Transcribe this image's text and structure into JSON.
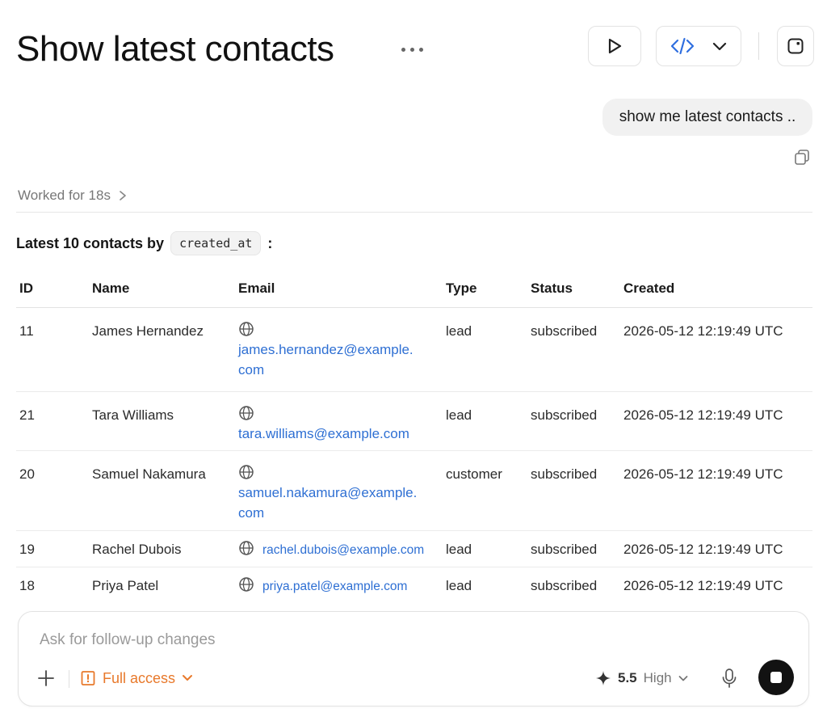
{
  "header": {
    "title": "Show latest contacts"
  },
  "conversation": {
    "user_message": "show me latest contacts ..",
    "worked_for": "Worked for 18s",
    "intro_prefix": "Latest 10 contacts by",
    "intro_code": "created_at",
    "intro_suffix": ":"
  },
  "table": {
    "columns": [
      "ID",
      "Name",
      "Email",
      "Type",
      "Status",
      "Created"
    ],
    "rows": [
      {
        "id": "11",
        "name": "James Hernandez",
        "email": "james.hernandez@example.com",
        "email_line1": "james.hernandez@example.",
        "email_line2": "com",
        "type": "lead",
        "status": "subscribed",
        "created": "2026-05-12 12:19:49 UTC"
      },
      {
        "id": "21",
        "name": "Tara Williams",
        "email": "tara.williams@example.com",
        "type": "lead",
        "status": "subscribed",
        "created": "2026-05-12 12:19:49 UTC"
      },
      {
        "id": "20",
        "name": "Samuel Nakamura",
        "email": "samuel.nakamura@example.com",
        "email_line1": "samuel.nakamura@example.",
        "email_line2": "com",
        "type": "customer",
        "status": "subscribed",
        "created": "2026-05-12 12:19:49 UTC"
      },
      {
        "id": "19",
        "name": "Rachel Dubois",
        "email": "rachel.dubois@example.com",
        "type": "lead",
        "status": "subscribed",
        "created": "2026-05-12 12:19:49 UTC"
      },
      {
        "id": "18",
        "name": "Priya Patel",
        "email": "priya.patel@example.com",
        "type": "lead",
        "status": "subscribed",
        "created": "2026-05-12 12:19:49 UTC"
      }
    ]
  },
  "composer": {
    "placeholder": "Ask for follow-up changes",
    "access_label": "Full access",
    "model_version": "5.5",
    "model_effort": "High"
  },
  "colors": {
    "link": "#2e6fd3",
    "access": "#e8792b",
    "code_icon": "#2f6fe0",
    "stop_button": "#121212"
  },
  "icons": {
    "more": "ellipsis-icon",
    "run": "play-icon",
    "code": "code-icon",
    "dropdown": "chevron-down-icon",
    "panel": "panel-toggle-icon",
    "copy": "copy-icon",
    "expand": "chevron-right-icon",
    "email": "globe-icon",
    "add": "plus-icon",
    "access": "shield-icon",
    "model": "sparkle-icon",
    "mic": "microphone-icon",
    "stop": "stop-icon"
  }
}
